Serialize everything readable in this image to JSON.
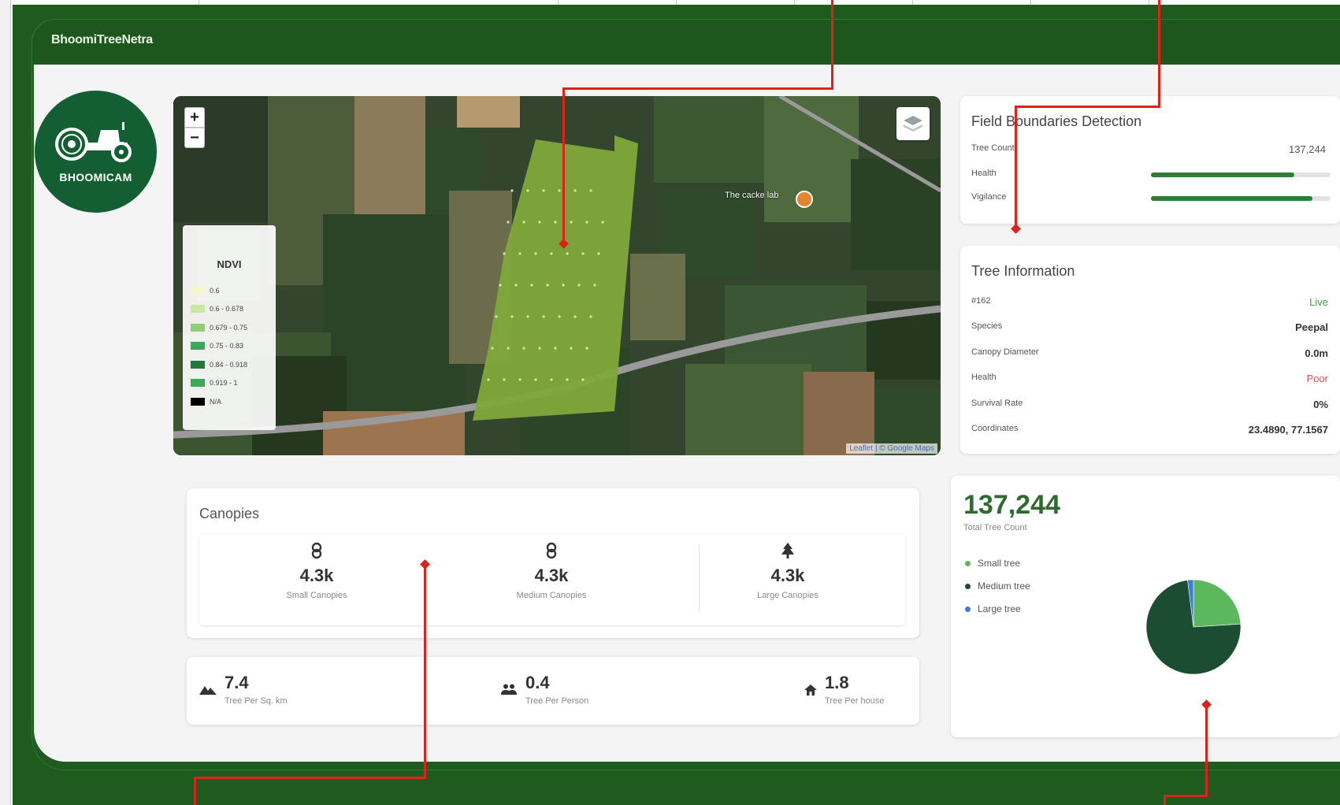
{
  "app": {
    "title": "BhoomiTreeNetra"
  },
  "logo": {
    "text": "BHOOMICAM"
  },
  "map": {
    "zoom_in": "+",
    "zoom_out": "−",
    "attribution": "Leaflet | © Google Maps",
    "poi_label": "The cacke lab",
    "legend": {
      "title": "NDVI",
      "items": [
        {
          "label": "0.6",
          "color": "#f6f6cc"
        },
        {
          "label": "0.6 - 0.678",
          "color": "#c9e6a3"
        },
        {
          "label": "0.679 - 0.75",
          "color": "#8fcf7c"
        },
        {
          "label": "0.75 - 0.83",
          "color": "#3fa65b"
        },
        {
          "label": "0.84 - 0.918",
          "color": "#1f7a3a"
        },
        {
          "label": "0.919 - 1",
          "color": "#3da85a"
        },
        {
          "label": "N/A",
          "color": "#000000"
        }
      ]
    }
  },
  "field_boundaries": {
    "title": "Field Boundaries Detection",
    "tree_count_label": "Tree Count",
    "tree_count_value": "137,244",
    "health_label": "Health",
    "health_level": 0.8,
    "vigilance_label": "Vigilance",
    "vigilance_level": 0.9
  },
  "tree_info": {
    "title": "Tree Information",
    "rows": [
      {
        "label": "#162",
        "value": "Live"
      },
      {
        "label": "Species",
        "value": "Peepal"
      },
      {
        "label": "Canopy Diameter",
        "value": "0.0m"
      },
      {
        "label": "Health",
        "value": "Poor"
      },
      {
        "label": "Survival Rate",
        "value": "0%"
      },
      {
        "label": "Coordinates",
        "value": "23.4890, 77.1567"
      }
    ]
  },
  "total": {
    "count": "137,244",
    "label": "Total Tree Count",
    "legend": [
      {
        "label": "Small tree",
        "color": "#5cb85c"
      },
      {
        "label": "Medium tree",
        "color": "#1b4d32"
      },
      {
        "label": "Large tree",
        "color": "#3a7fd5"
      }
    ]
  },
  "chart_data": {
    "type": "pie",
    "categories": [
      "Small tree",
      "Medium tree",
      "Large tree"
    ],
    "values": [
      24,
      74,
      2
    ],
    "colors": [
      "#5cb85c",
      "#1b4d32",
      "#3a7fd5"
    ]
  },
  "canopies": {
    "title": "Canopies",
    "items": [
      {
        "icon": "small-tree-icon",
        "value": "4.3k",
        "label": "Small Canopies"
      },
      {
        "icon": "medium-tree-icon",
        "value": "4.3k",
        "label": "Medium Canopies"
      },
      {
        "icon": "large-tree-icon",
        "value": "4.3k",
        "label": "Large Canopies"
      }
    ]
  },
  "density": {
    "items": [
      {
        "icon": "terrain-icon",
        "value": "7.4",
        "label": "Tree Per Sq. km"
      },
      {
        "icon": "people-icon",
        "value": "0.4",
        "label": "Tree Per Person"
      },
      {
        "icon": "house-icon",
        "value": "1.8",
        "label": "Tree Per house"
      }
    ]
  },
  "colors": {
    "brand_green": "#1f5a1f",
    "accent_green": "#2e7d32",
    "annotation_red": "#e0201a"
  }
}
